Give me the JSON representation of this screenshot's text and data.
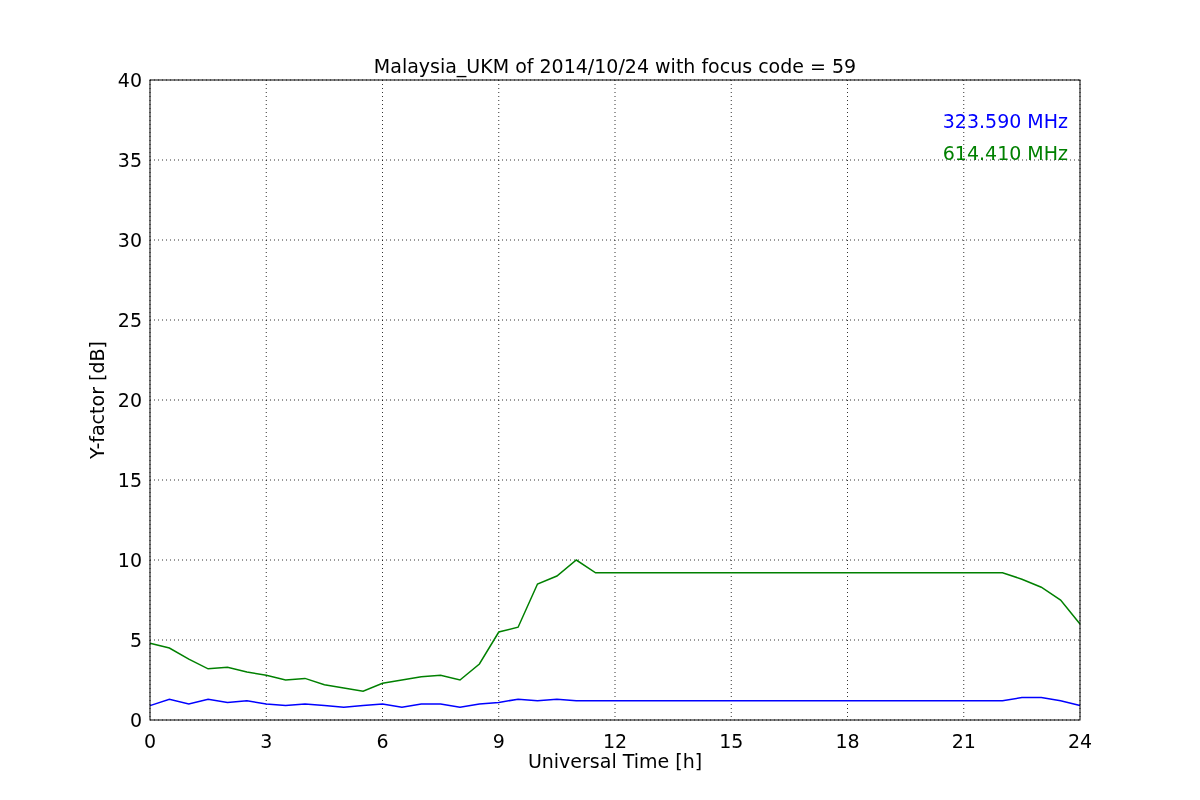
{
  "figure": {
    "chart_data": {
      "type": "line",
      "title": "Malaysia_UKM of 2014/10/24 with focus code = 59",
      "xlabel": "Universal Time [h]",
      "ylabel": "Y-factor [dB]",
      "x": [
        0,
        0.5,
        1,
        1.5,
        2,
        2.5,
        3,
        3.5,
        4,
        4.5,
        5,
        5.5,
        6,
        6.5,
        7,
        7.5,
        8,
        8.5,
        9,
        9.5,
        10,
        10.5,
        11,
        11.5,
        12,
        13,
        14,
        15,
        16,
        17,
        18,
        19,
        20,
        21,
        22,
        22.5,
        23,
        23.5,
        24
      ],
      "series": [
        {
          "name": "323.590 MHz",
          "color": "#0000ff",
          "values": [
            0.9,
            1.3,
            1.0,
            1.3,
            1.1,
            1.2,
            1.0,
            0.9,
            1.0,
            0.9,
            0.8,
            0.9,
            1.0,
            0.8,
            1.0,
            1.0,
            0.8,
            1.0,
            1.1,
            1.3,
            1.2,
            1.3,
            1.2,
            1.2,
            1.2,
            1.2,
            1.2,
            1.2,
            1.2,
            1.2,
            1.2,
            1.2,
            1.2,
            1.2,
            1.2,
            1.4,
            1.4,
            1.2,
            0.9
          ]
        },
        {
          "name": "614.410 MHz",
          "color": "#008000",
          "values": [
            4.8,
            4.5,
            3.8,
            3.2,
            3.3,
            3.0,
            2.8,
            2.5,
            2.6,
            2.2,
            2.0,
            1.8,
            2.3,
            2.5,
            2.7,
            2.8,
            2.5,
            3.5,
            5.5,
            5.8,
            8.5,
            9.0,
            10.0,
            9.2,
            9.2,
            9.2,
            9.2,
            9.2,
            9.2,
            9.2,
            9.2,
            9.2,
            9.2,
            9.2,
            9.2,
            8.8,
            8.3,
            7.5,
            6.0
          ]
        }
      ],
      "xlim": [
        0,
        24
      ],
      "ylim": [
        0,
        40
      ],
      "xticks": [
        0,
        3,
        6,
        9,
        12,
        15,
        18,
        21,
        24
      ],
      "yticks": [
        0,
        5,
        10,
        15,
        20,
        25,
        30,
        35,
        40
      ],
      "grid": true
    }
  }
}
